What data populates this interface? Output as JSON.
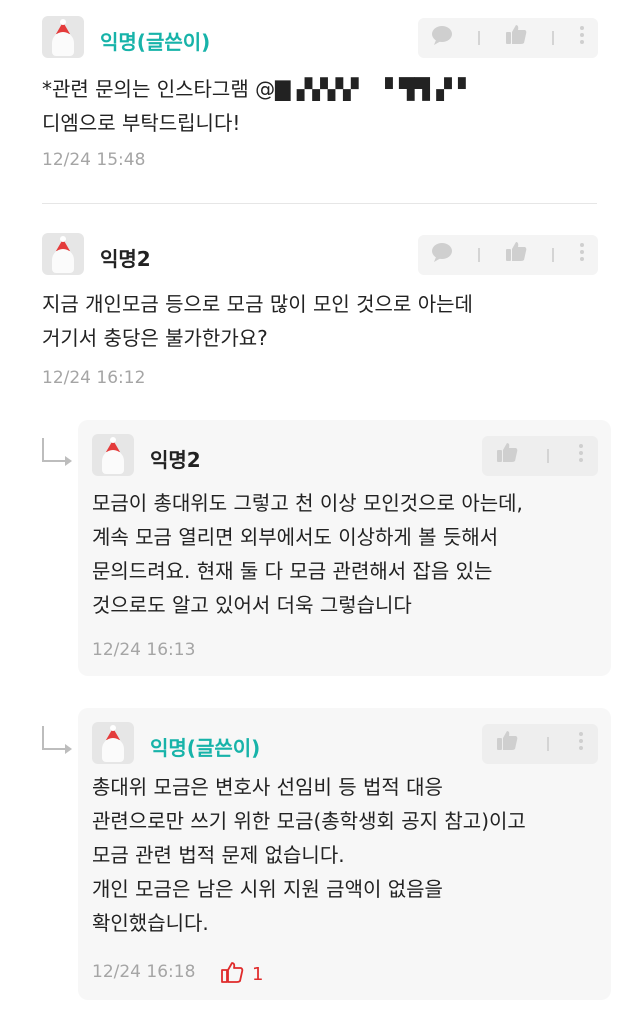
{
  "comments": [
    {
      "author": "익명(글쓴이)",
      "text": "*관련 문의는 인스타그램 @▇ ▞▞▞▞   ▝ ▜▜ ▞ ▘\n디엠으로 부탁드립니다!",
      "time": "12/24 15:48"
    },
    {
      "author": "익명2",
      "text": "지금 개인모금 등으로 모금 많이 모인 것으로 아는데\n거기서 충당은 불가한가요?",
      "time": "12/24 16:12"
    }
  ],
  "replies": [
    {
      "author": "익명2",
      "text": "모금이 총대위도 그렇고 천 이상 모인것으로 아는데,\n계속 모금 열리면 외부에서도 이상하게 볼 듯해서\n문의드려요. 현재 둘 다 모금 관련해서 잡음 있는\n것으로도 알고 있어서 더욱 그렇습니다",
      "time": "12/24 16:13"
    },
    {
      "author": "익명(글쓴이)",
      "text": "총대위 모금은 변호사 선임비 등 법적 대응\n관련으로만 쓰기 위한 모금(총학생회 공지 참고)이고\n모금 관련 법적 문제 없습니다.\n개인 모금은 남은 시위 지원 금액이 없음을\n확인했습니다.",
      "time": "12/24 16:18",
      "likes": "1"
    }
  ],
  "icons": {
    "comment": "speech-bubble-icon",
    "like": "thumbs-up-icon",
    "more": "more-vertical-icon",
    "reply": "reply-arrow-icon"
  },
  "colors": {
    "op_name": "#17b3a9",
    "like_count": "#e02b2b"
  }
}
